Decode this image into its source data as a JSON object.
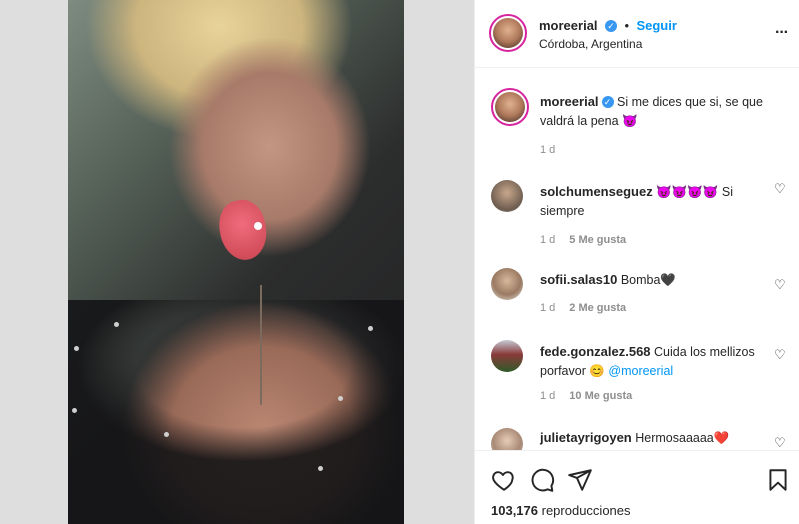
{
  "post": {
    "media_type": "video-photo",
    "views_count": "103,176",
    "views_label": "reproducciones"
  },
  "header": {
    "username": "moreerial",
    "verified_glyph": "✓",
    "separator": "•",
    "follow_label": "Seguir",
    "location": "Córdoba, Argentina",
    "more_icon": "more-options-icon",
    "more_glyph": "···"
  },
  "caption": {
    "username": "moreerial",
    "text": "Si me dices que si, se que valdrá la pena 😈",
    "time": "1 d"
  },
  "comments": [
    {
      "username": "solchumenseguez",
      "text": "😈😈😈😈 Si siempre",
      "time": "1 d",
      "likes": "5 Me gusta"
    },
    {
      "username": "sofii.salas10",
      "text": "Bomba🖤",
      "time": "1 d",
      "likes": "2 Me gusta"
    },
    {
      "username": "fede.gonzalez.568",
      "text": "Cuida los mellizos porfavor 😊",
      "mention": "@moreerial",
      "time": "1 d",
      "likes": "10 Me gusta"
    },
    {
      "username": "julietayrigoyen",
      "text": "Hermosaaaaa❤️",
      "extra": "❤️❤️"
    }
  ],
  "actions": {
    "like_icon": "heart-icon",
    "comment_icon": "comment-icon",
    "share_icon": "paper-plane-icon",
    "save_icon": "bookmark-icon"
  },
  "colors": {
    "accent_blue": "#0095f6",
    "verified_blue": "#3897f0",
    "story_ring": "#d6249f",
    "text": "#262626",
    "muted": "#8e8e8e"
  }
}
